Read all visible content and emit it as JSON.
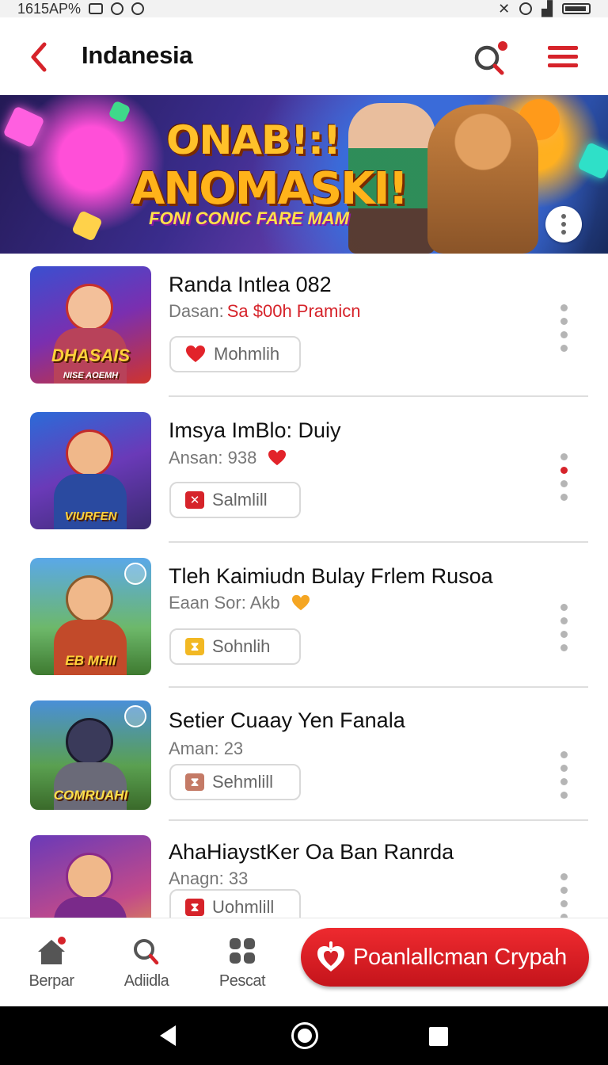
{
  "status_bar": {
    "time": "1615AP%"
  },
  "header": {
    "title": "Indanesia",
    "accent_color": "#d6232a"
  },
  "banner": {
    "title_line_1": "ONAB!:!",
    "title_line_2": "ANOMASKI!",
    "subtitle": "FONI CONIC FARE MAM"
  },
  "games": [
    {
      "title": "Randa Intlea 082",
      "subtitle_prefix": "Dasan:",
      "subtitle_highlight": "Sa $00h Pramicn",
      "subtitle_icon": "",
      "button_label": "Mohmlih",
      "button_icon": "heart-icon",
      "thumb_label": "DHASAIS",
      "thumb_caption": "NISE AOEMH"
    },
    {
      "title": "Imsya ImBlo: Duiy",
      "subtitle_prefix": "Ansan: 938",
      "subtitle_highlight": "",
      "subtitle_icon": "heart-icon",
      "button_label": "Salmlill",
      "button_icon": "x-square-icon",
      "thumb_label": "VIURFEN",
      "thumb_caption": ""
    },
    {
      "title": "Tleh Kaimiudn Bulay Frlem Rusoa",
      "subtitle_prefix": "Eaan Sor: Akb",
      "subtitle_highlight": "",
      "subtitle_icon": "orange-heart-icon",
      "button_label": "Sohnlih",
      "button_icon": "hourglass-icon",
      "thumb_label": "EB MHII",
      "thumb_caption": ""
    },
    {
      "title": "Setier Cuaay Yen Fanala",
      "subtitle_prefix": "Aman: 23",
      "subtitle_highlight": "",
      "subtitle_icon": "",
      "button_label": "Sehmlill",
      "button_icon": "hourglass-icon",
      "thumb_label": "COMRUAHI",
      "thumb_caption": ""
    },
    {
      "title": "AhaHiaystKer Oa Ban Ranrda",
      "subtitle_prefix": "Anagn: 33",
      "subtitle_highlight": "",
      "subtitle_icon": "",
      "button_label": "Uohmlill",
      "button_icon": "hourglass-icon",
      "thumb_label": "",
      "thumb_caption": ""
    }
  ],
  "bottom_nav": {
    "items": [
      {
        "label": "Berpar",
        "icon": "home-icon"
      },
      {
        "label": "Adiidla",
        "icon": "search-icon"
      },
      {
        "label": "Pescat",
        "icon": "grid-icon"
      }
    ],
    "cta_label": "Poanlallcman Crypah"
  }
}
